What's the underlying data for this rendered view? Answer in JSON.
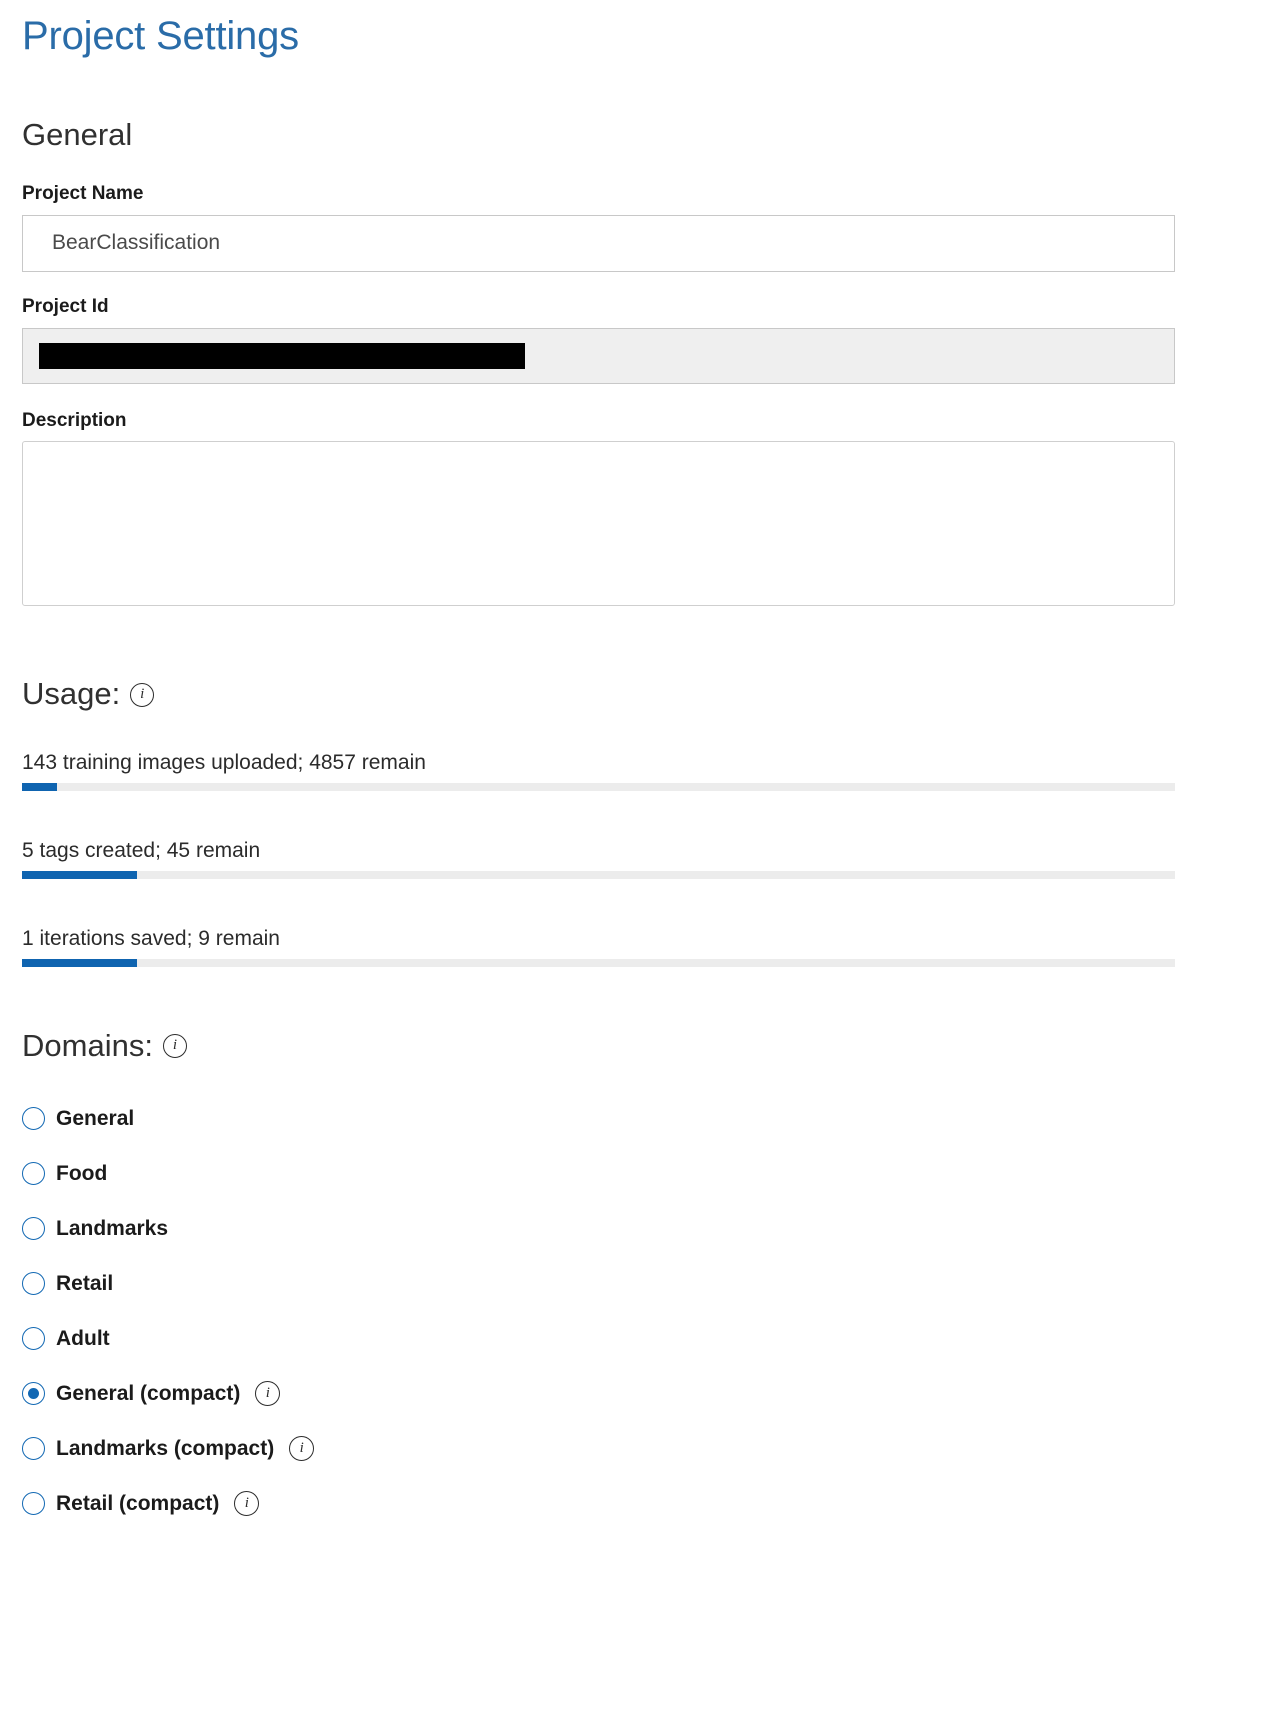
{
  "page": {
    "title": "Project Settings"
  },
  "general": {
    "heading": "General",
    "project_name": {
      "label": "Project Name",
      "value": "BearClassification",
      "placeholder": ""
    },
    "project_id": {
      "label": "Project Id",
      "value": "",
      "redacted": true
    },
    "description": {
      "label": "Description",
      "value": "",
      "placeholder": ""
    }
  },
  "usage": {
    "heading": "Usage:",
    "info_icon": "info-icon",
    "info_glyph": "i",
    "rows": [
      {
        "text": "143 training images uploaded; 4857 remain",
        "used": 143,
        "remain": 4857,
        "total": 5000,
        "percent": 3
      },
      {
        "text": "5 tags created; 45 remain",
        "used": 5,
        "remain": 45,
        "total": 50,
        "percent": 10
      },
      {
        "text": "1 iterations saved; 9 remain",
        "used": 1,
        "remain": 9,
        "total": 10,
        "percent": 10
      }
    ]
  },
  "domains": {
    "heading": "Domains:",
    "info_glyph": "i",
    "items": [
      {
        "label": "General",
        "selected": false,
        "has_info": false
      },
      {
        "label": "Food",
        "selected": false,
        "has_info": false
      },
      {
        "label": "Landmarks",
        "selected": false,
        "has_info": false
      },
      {
        "label": "Retail",
        "selected": false,
        "has_info": false
      },
      {
        "label": "Adult",
        "selected": false,
        "has_info": false
      },
      {
        "label": "General (compact)",
        "selected": true,
        "has_info": true
      },
      {
        "label": "Landmarks (compact)",
        "selected": false,
        "has_info": true
      },
      {
        "label": "Retail (compact)",
        "selected": false,
        "has_info": true
      }
    ]
  },
  "colors": {
    "title_blue": "#2a6ca8",
    "progress_blue": "#0f64b0",
    "radio_blue": "#1268b3",
    "track_gray": "#ececec",
    "readonly_bg": "#efefef"
  }
}
